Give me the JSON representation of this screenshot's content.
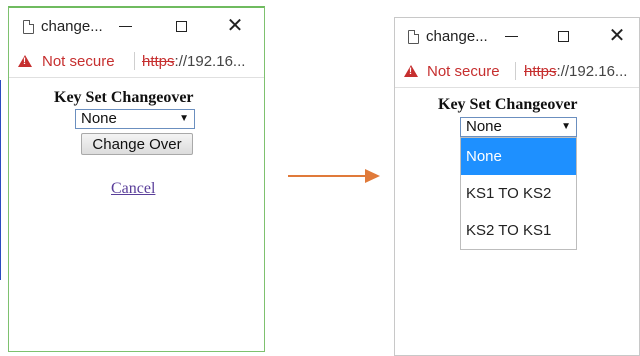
{
  "left_window": {
    "tab_title": "change...",
    "not_secure": "Not secure",
    "url_scheme": "https",
    "url_rest": "://192.16...",
    "heading": "Key Set Changeover",
    "select_value": "None",
    "button_label": "Change Over",
    "cancel_label": "Cancel"
  },
  "right_window": {
    "tab_title": "change...",
    "not_secure": "Not secure",
    "url_scheme": "https",
    "url_rest": "://192.16...",
    "heading": "Key Set Changeover",
    "select_value": "None",
    "options": [
      "None",
      "KS1 TO KS2",
      "KS2 TO KS1"
    ]
  },
  "colors": {
    "warning": "#c62f2f",
    "arrow": "#e07a3a",
    "option_highlight": "#1e90ff",
    "link": "#5a3e9a"
  },
  "icons": {
    "page": "page-icon",
    "minimize": "minimize-icon",
    "maximize": "maximize-icon",
    "close": "close-icon",
    "warning": "warning-icon",
    "dropdown": "chevron-down-icon",
    "flow": "arrow-right-icon"
  }
}
